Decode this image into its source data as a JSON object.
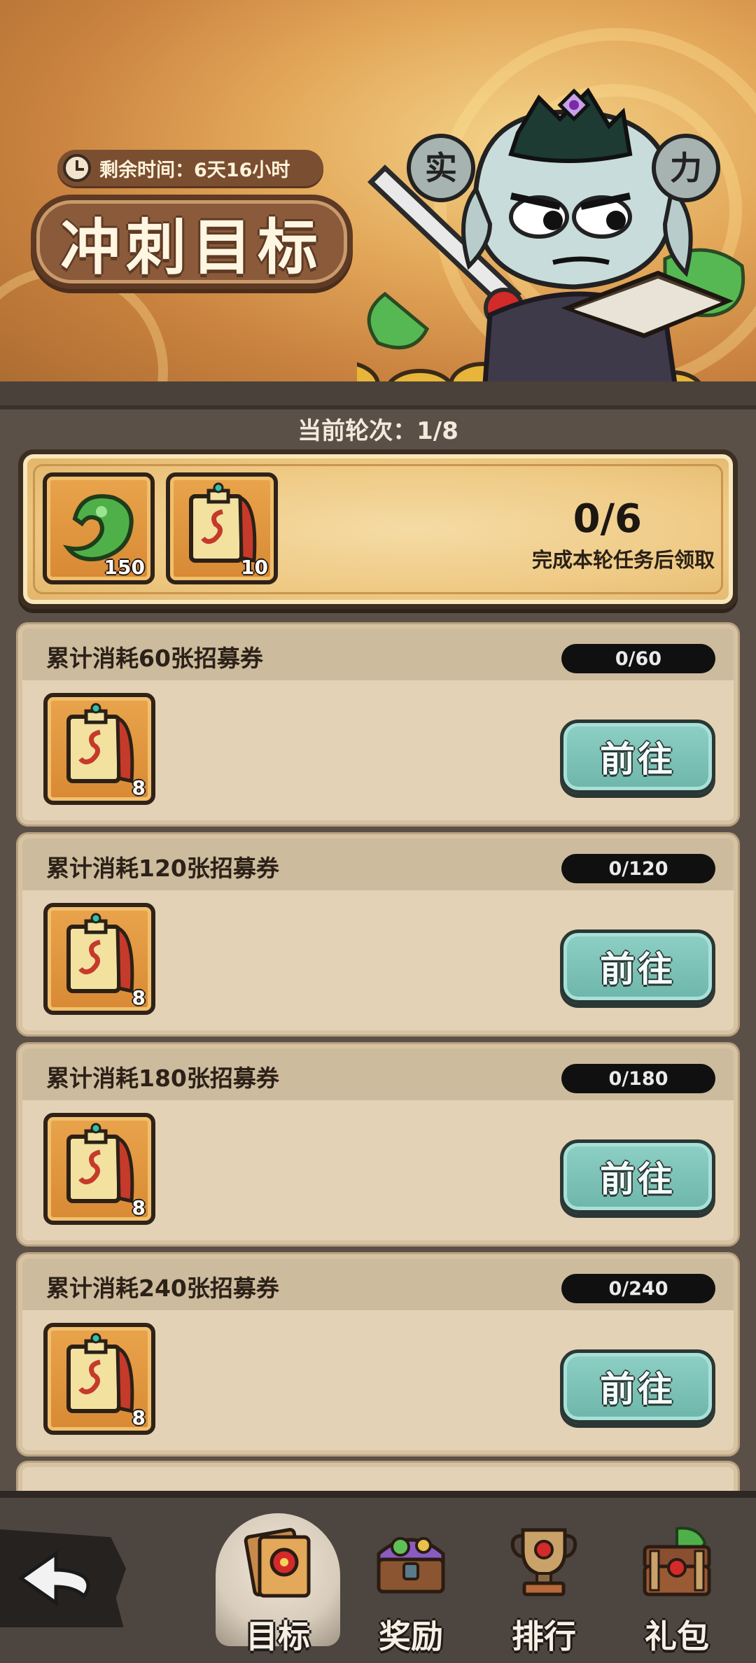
{
  "banner": {
    "timer_text": "剩余时间：6天16小时",
    "title": "冲刺目标"
  },
  "round": {
    "label": "当前轮次：1/8",
    "rewards": [
      {
        "icon": "jade-swirl-icon",
        "count": "150"
      },
      {
        "icon": "recruit-scroll-icon",
        "count": "10"
      }
    ],
    "progress": "0/6",
    "hint": "完成本轮任务后领取"
  },
  "tasks": [
    {
      "title": "累计消耗60张招募券",
      "progress": "0/60",
      "reward_icon": "recruit-scroll-icon",
      "reward_count": "8",
      "button": "前往"
    },
    {
      "title": "累计消耗120张招募券",
      "progress": "0/120",
      "reward_icon": "recruit-scroll-icon",
      "reward_count": "8",
      "button": "前往"
    },
    {
      "title": "累计消耗180张招募券",
      "progress": "0/180",
      "reward_icon": "recruit-scroll-icon",
      "reward_count": "8",
      "button": "前往"
    },
    {
      "title": "累计消耗240张招募券",
      "progress": "0/240",
      "reward_icon": "recruit-scroll-icon",
      "reward_count": "8",
      "button": "前往"
    }
  ],
  "nav": {
    "back_icon": "back-arrow-icon",
    "tabs": [
      {
        "label": "目标",
        "icon": "target-card-icon",
        "active": true
      },
      {
        "label": "奖励",
        "icon": "treasure-chest-icon",
        "active": false
      },
      {
        "label": "排行",
        "icon": "trophy-icon",
        "active": false
      },
      {
        "label": "礼包",
        "icon": "gift-chest-icon",
        "active": false
      }
    ]
  },
  "colors": {
    "background": "#5a5048",
    "card": "#e4d2b6",
    "go_button": "#7cc3b8",
    "banner": "#e3a85a"
  }
}
